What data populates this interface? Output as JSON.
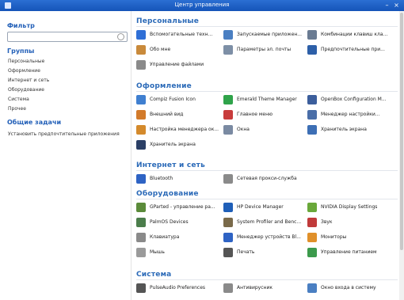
{
  "window": {
    "title": "Центр управления"
  },
  "sidebar": {
    "filter_label": "Фильтр",
    "filter_value": "",
    "groups_label": "Группы",
    "groups": [
      "Персональные",
      "Оформление",
      "Интернет и сеть",
      "Оборудование",
      "Система",
      "Прочее"
    ],
    "tasks_label": "Общие задачи",
    "tasks": [
      "Установить предпочтительные приложения"
    ]
  },
  "sections": [
    {
      "title": "Персональные",
      "items": [
        {
          "label": "Вспомогательные техн...",
          "color": "#2f6fd6",
          "icon": "accessibility-icon"
        },
        {
          "label": "Запускаемые приложен...",
          "color": "#4a7fc2",
          "icon": "startup-apps-icon"
        },
        {
          "label": "Комбинации клавиш кла...",
          "color": "#6a7b92",
          "icon": "keyboard-shortcuts-icon"
        },
        {
          "label": "Обо мне",
          "color": "#c98a3b",
          "icon": "about-me-icon"
        },
        {
          "label": "Параметры эл. почты",
          "color": "#7d8fa6",
          "icon": "mail-settings-icon"
        },
        {
          "label": "Предпочтительные при...",
          "color": "#2d5fa8",
          "icon": "preferred-apps-icon"
        },
        {
          "label": "Управление файлами",
          "color": "#8a8a8a",
          "icon": "file-management-icon"
        }
      ]
    },
    {
      "title": "Оформление",
      "items": [
        {
          "label": "Compiz Fusion Icon",
          "color": "#3f7fd0",
          "icon": "compiz-icon"
        },
        {
          "label": "Emerald Theme Manager",
          "color": "#2fa34a",
          "icon": "emerald-icon"
        },
        {
          "label": "OpenBox Configuration M...",
          "color": "#3c5e9c",
          "icon": "openbox-icon"
        },
        {
          "label": "Внешний вид",
          "color": "#d27a2a",
          "icon": "appearance-icon"
        },
        {
          "label": "Главное меню",
          "color": "#c83c3c",
          "icon": "main-menu-icon"
        },
        {
          "label": "Менеджер настройки...",
          "color": "#4a6ea8",
          "icon": "settings-manager-icon"
        },
        {
          "label": "Настройка менеджера ок...",
          "color": "#d48a2c",
          "icon": "window-manager-icon"
        },
        {
          "label": "Окна",
          "color": "#7a8aa2",
          "icon": "windows-icon"
        },
        {
          "label": "Хранитель экрана",
          "color": "#3d6fb5",
          "icon": "screensaver-icon"
        },
        {
          "label": "Хранитель экрана",
          "color": "#2b3f66",
          "icon": "screensaver-alt-icon"
        }
      ]
    },
    {
      "title": "Интернет и сеть",
      "items": [
        {
          "label": "Bluetooth",
          "color": "#2e63c4",
          "icon": "bluetooth-icon"
        },
        {
          "label": "Сетевая прокси-служба",
          "color": "#8a8a8a",
          "icon": "network-proxy-icon"
        }
      ]
    },
    {
      "title": "Оборудование",
      "items": [
        {
          "label": "GParted - управление ра...",
          "color": "#5b8b3a",
          "icon": "gparted-icon"
        },
        {
          "label": "HP Device Manager",
          "color": "#1f5fb8",
          "icon": "hp-device-icon"
        },
        {
          "label": "NVIDIA Display Settings",
          "color": "#6aa83a",
          "icon": "nvidia-icon"
        },
        {
          "label": "PalmOS Devices",
          "color": "#4b7d4b",
          "icon": "palm-icon"
        },
        {
          "label": "System Profiler and Benc...",
          "color": "#7a6a4a",
          "icon": "profiler-icon"
        },
        {
          "label": "Звук",
          "color": "#c03a3a",
          "icon": "sound-icon"
        },
        {
          "label": "Клавиатура",
          "color": "#8a8a8a",
          "icon": "keyboard-icon"
        },
        {
          "label": "Менеджер устройств Bl...",
          "color": "#2e63c4",
          "icon": "bluetooth-manager-icon"
        },
        {
          "label": "Мониторы",
          "color": "#e0902a",
          "icon": "monitors-icon"
        },
        {
          "label": "Мышь",
          "color": "#9a9a9a",
          "icon": "mouse-icon"
        },
        {
          "label": "Печать",
          "color": "#555555",
          "icon": "printer-icon"
        },
        {
          "label": "Управление питанием",
          "color": "#3c9a4c",
          "icon": "power-icon"
        }
      ]
    },
    {
      "title": "Система",
      "items": [
        {
          "label": "PulseAudio Preferences",
          "color": "#555555",
          "icon": "pulseaudio-icon"
        },
        {
          "label": "Антивирусник",
          "color": "#8a8a8a",
          "icon": "antivirus-icon"
        },
        {
          "label": "Окно входа в систему",
          "color": "#4a7fc2",
          "icon": "login-window-icon"
        }
      ]
    }
  ]
}
